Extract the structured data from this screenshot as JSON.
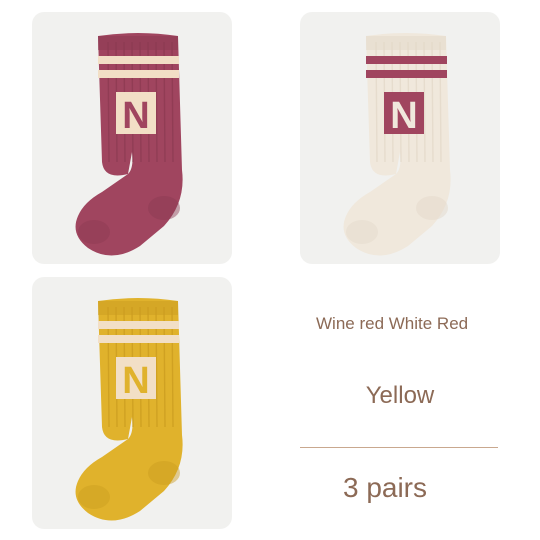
{
  "products": [
    {
      "name": "Wine red",
      "sock_color": "#a0455f",
      "sock_shade": "#8a3a51",
      "stripe_color": "#f2dfc6",
      "letter": "N",
      "letter_color": "#a0455f",
      "letter_bg": "#f2dfc6"
    },
    {
      "name": "White",
      "sock_color": "#f0e8dc",
      "sock_shade": "#e2d7c7",
      "stripe_color": "#a0455f",
      "letter": "N",
      "letter_color": "#f0e8dc",
      "letter_bg": "#a0455f"
    },
    {
      "name": "Yellow",
      "sock_color": "#e0b22c",
      "sock_shade": "#c99b1f",
      "stripe_color": "#f2dfc6",
      "letter": "N",
      "letter_color": "#e0b22c",
      "letter_bg": "#f2dfc6"
    }
  ],
  "labels": {
    "colors_line": "Wine red White Red",
    "yellow": "Yellow",
    "pairs": "3 pairs"
  },
  "colors": {
    "tile_bg": "#f1f1ef",
    "text": "#8c6a56",
    "divider": "#c9a88f"
  }
}
